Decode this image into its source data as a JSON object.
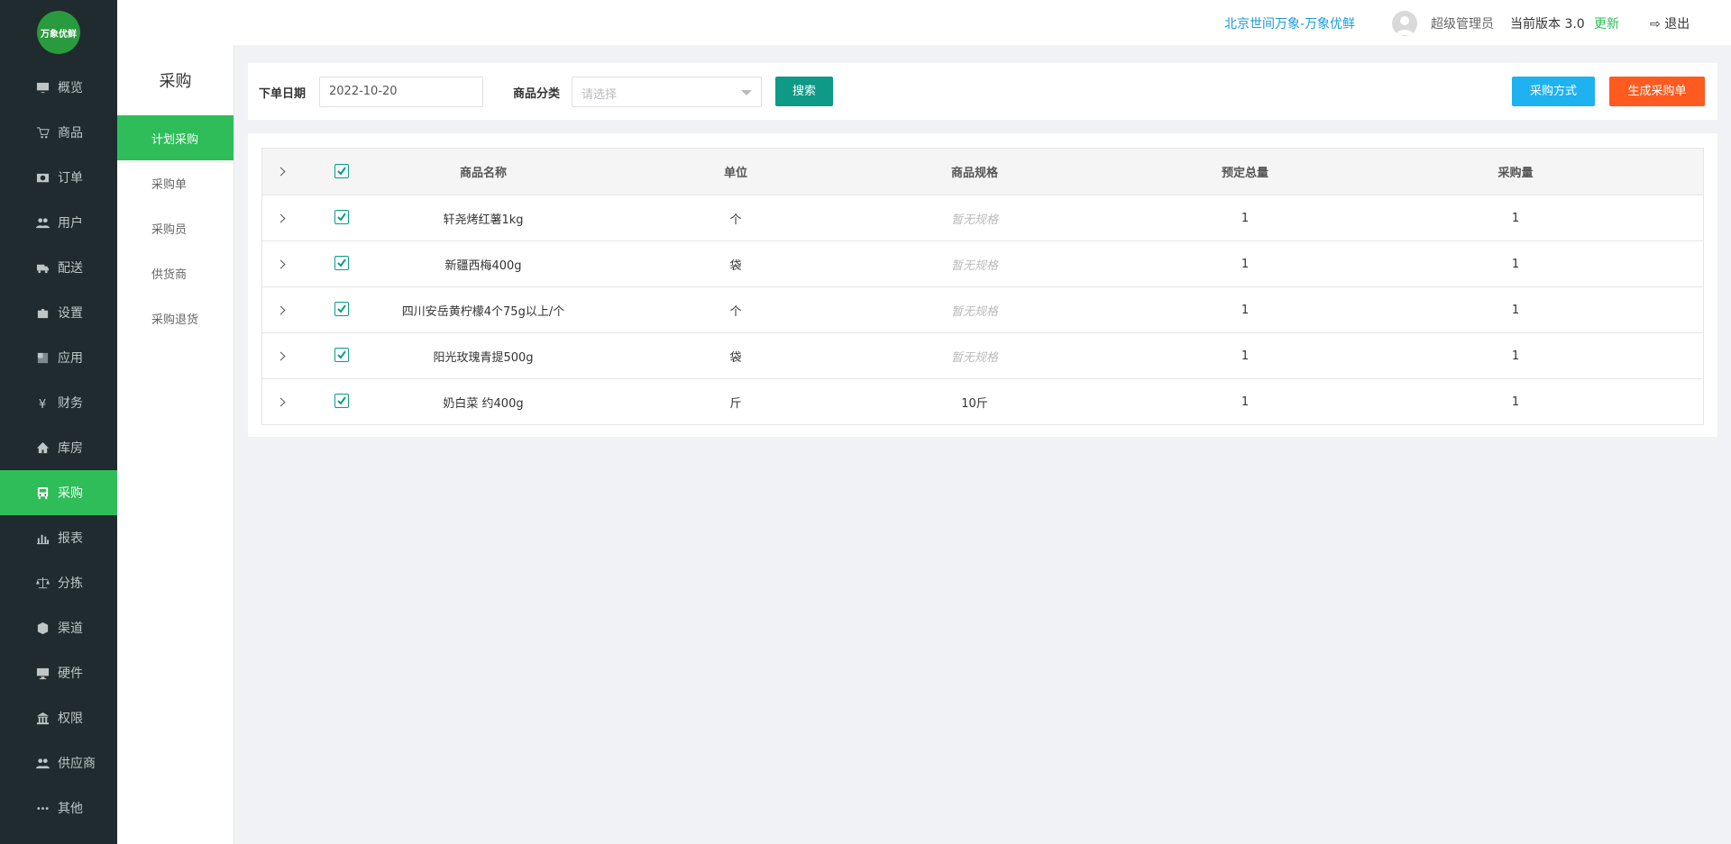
{
  "sidebar": {
    "logo_text": "万象优鲜",
    "items": [
      {
        "label": "概览",
        "icon": "monitor-icon"
      },
      {
        "label": "商品",
        "icon": "cart-icon"
      },
      {
        "label": "订单",
        "icon": "money-icon"
      },
      {
        "label": "用户",
        "icon": "users-icon"
      },
      {
        "label": "配送",
        "icon": "truck-icon"
      },
      {
        "label": "设置",
        "icon": "puzzle-icon"
      },
      {
        "label": "应用",
        "icon": "app-icon"
      },
      {
        "label": "财务",
        "icon": "yen-icon"
      },
      {
        "label": "库房",
        "icon": "home-icon"
      },
      {
        "label": "采购",
        "icon": "bus-icon",
        "active": true
      },
      {
        "label": "报表",
        "icon": "chart-icon"
      },
      {
        "label": "分拣",
        "icon": "scale-icon"
      },
      {
        "label": "渠道",
        "icon": "cube-icon"
      },
      {
        "label": "硬件",
        "icon": "desktop-icon"
      },
      {
        "label": "权限",
        "icon": "bank-icon"
      },
      {
        "label": "供应商",
        "icon": "users-icon"
      },
      {
        "label": "其他",
        "icon": "more-icon"
      }
    ]
  },
  "header": {
    "company": "北京世间万象-万象优鲜",
    "user": "超级管理员",
    "version_label": "当前版本  3.0",
    "update": "更新",
    "logout": "退出"
  },
  "subnav": {
    "title": "采购",
    "items": [
      {
        "label": "计划采购",
        "active": true
      },
      {
        "label": "采购单"
      },
      {
        "label": "采购员"
      },
      {
        "label": "供货商"
      },
      {
        "label": "采购退货"
      }
    ]
  },
  "filter": {
    "date_label": "下单日期",
    "date_value": "2022-10-20",
    "category_label": "商品分类",
    "category_placeholder": "请选择",
    "search": "搜索",
    "method_button": "采购方式",
    "generate_button": "生成采购单"
  },
  "table": {
    "columns": [
      "商品名称",
      "单位",
      "商品规格",
      "预定总量",
      "采购量"
    ],
    "rows": [
      {
        "name": "轩尧烤红薯1kg",
        "unit": "个",
        "spec": "暂无规格",
        "spec_empty": true,
        "total": "1",
        "qty": "1"
      },
      {
        "name": "新疆西梅400g",
        "unit": "袋",
        "spec": "暂无规格",
        "spec_empty": true,
        "total": "1",
        "qty": "1"
      },
      {
        "name": "四川安岳黄柠檬4个75g以上/个",
        "unit": "个",
        "spec": "暂无规格",
        "spec_empty": true,
        "total": "1",
        "qty": "1"
      },
      {
        "name": "阳光玫瑰青提500g",
        "unit": "袋",
        "spec": "暂无规格",
        "spec_empty": true,
        "total": "1",
        "qty": "1"
      },
      {
        "name": "奶白菜 约400g",
        "unit": "斤",
        "spec": "10斤",
        "spec_empty": false,
        "total": "1",
        "qty": "1"
      }
    ]
  }
}
